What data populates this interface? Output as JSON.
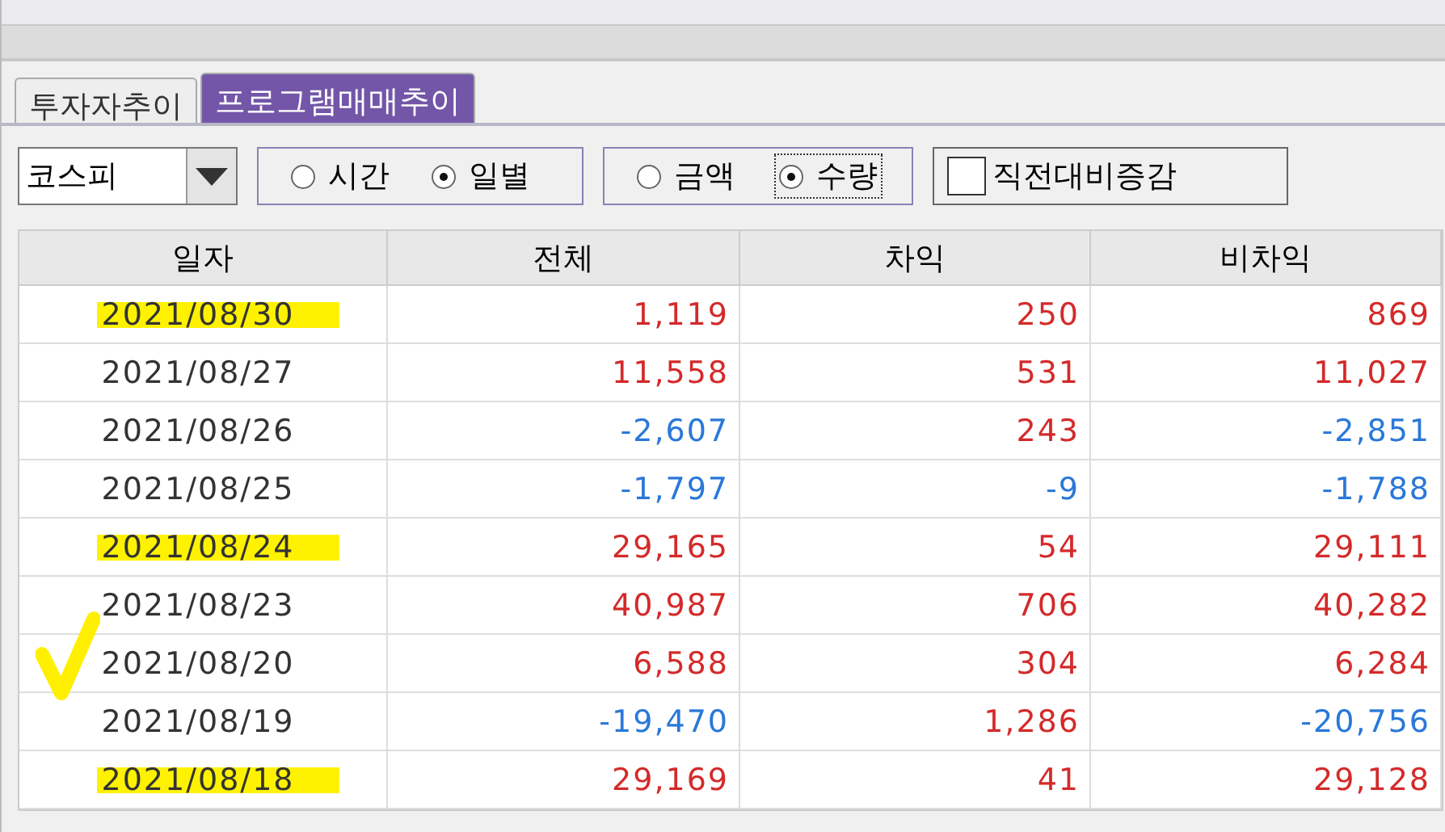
{
  "tabs": [
    {
      "label": "투자자추이",
      "selected": false
    },
    {
      "label": "프로그램매매추이",
      "selected": true
    }
  ],
  "market_select": {
    "value": "코스피"
  },
  "period_options": [
    {
      "label": "시간",
      "selected": false
    },
    {
      "label": "일별",
      "selected": true
    }
  ],
  "unit_options": [
    {
      "label": "금액",
      "selected": false
    },
    {
      "label": "수량",
      "selected": true
    }
  ],
  "compare_checkbox": {
    "label": "직전대비증감",
    "checked": false
  },
  "table": {
    "columns": [
      "일자",
      "전체",
      "차익",
      "비차익"
    ],
    "rows": [
      {
        "cells": [
          "2021/08/30",
          "1,119",
          "250",
          "869"
        ],
        "highlight": true,
        "tick": false
      },
      {
        "cells": [
          "2021/08/27",
          "11,558",
          "531",
          "11,027"
        ],
        "highlight": false,
        "tick": false
      },
      {
        "cells": [
          "2021/08/26",
          "-2,607",
          "243",
          "-2,851"
        ],
        "highlight": false,
        "tick": false
      },
      {
        "cells": [
          "2021/08/25",
          "-1,797",
          "-9",
          "-1,788"
        ],
        "highlight": false,
        "tick": false
      },
      {
        "cells": [
          "2021/08/24",
          "29,165",
          "54",
          "29,111"
        ],
        "highlight": true,
        "tick": false
      },
      {
        "cells": [
          "2021/08/23",
          "40,987",
          "706",
          "40,282"
        ],
        "highlight": false,
        "tick": false
      },
      {
        "cells": [
          "2021/08/20",
          "6,588",
          "304",
          "6,284"
        ],
        "highlight": false,
        "tick": true
      },
      {
        "cells": [
          "2021/08/19",
          "-19,470",
          "1,286",
          "-20,756"
        ],
        "highlight": false,
        "tick": false
      },
      {
        "cells": [
          "2021/08/18",
          "29,169",
          "41",
          "29,128"
        ],
        "highlight": true,
        "tick": false
      }
    ]
  }
}
